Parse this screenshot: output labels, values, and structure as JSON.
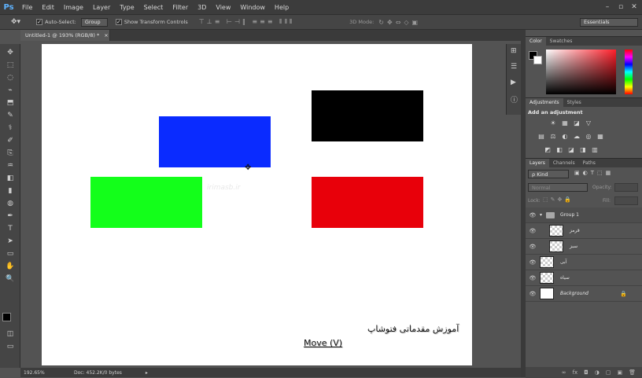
{
  "app": {
    "logo": "Ps"
  },
  "menu": [
    "File",
    "Edit",
    "Image",
    "Layer",
    "Type",
    "Select",
    "Filter",
    "3D",
    "View",
    "Window",
    "Help"
  ],
  "window_controls": [
    "–",
    "▫",
    "✕"
  ],
  "options": {
    "auto_select_label": "Auto-Select:",
    "auto_select_value": "Group",
    "show_transform_label": "Show Transform Controls",
    "mode_3d_label": "3D Mode:",
    "workspace_value": "Essentials"
  },
  "document": {
    "tab_title": "Untitled-1 @ 193% (RGB/8) *",
    "tab_close": "×",
    "zoom": "192.65%",
    "doc_info": "Doc: 452.2K/0 bytes",
    "status_arrow": "▸"
  },
  "canvas": {
    "watermark": "irimasb.ir",
    "shapes": [
      {
        "name": "blue",
        "color": "#0a2bff"
      },
      {
        "name": "black",
        "color": "#000000"
      },
      {
        "name": "green",
        "color": "#13ff1a"
      },
      {
        "name": "red",
        "color": "#e8000a"
      }
    ]
  },
  "overlay": {
    "persian_title": "آموزش مقدماتی فتوشاپ",
    "tool_caption": "Move (V)"
  },
  "color_panel": {
    "tabs": [
      "Color",
      "Swatches"
    ],
    "fg": "#000000",
    "bg": "#ffffff"
  },
  "adjustments_panel": {
    "tabs": [
      "Adjustments",
      "Styles"
    ],
    "heading": "Add an adjustment",
    "icons_row1": [
      "☀",
      "▦",
      "◪",
      "▽"
    ],
    "icons_row2": [
      "▤",
      "⚖",
      "◐",
      "☁",
      "◎",
      "▦"
    ],
    "icons_row3": [
      "◩",
      "◧",
      "◪",
      "◨",
      "▥"
    ]
  },
  "layers_panel": {
    "tabs": [
      "Layers",
      "Channels",
      "Paths"
    ],
    "filter_label": "ρ Kind",
    "blend_mode": "Normal",
    "opacity_label": "Opacity:",
    "fill_label": "Fill:",
    "lock_label": "Lock:",
    "layers": [
      {
        "name": "Group 1",
        "type": "group"
      },
      {
        "name": "قرمز",
        "type": "layer"
      },
      {
        "name": "سبز",
        "type": "layer"
      },
      {
        "name": "آبی",
        "type": "layer"
      },
      {
        "name": "سیاه",
        "type": "layer"
      },
      {
        "name": "Background",
        "type": "background"
      }
    ],
    "footer_icons": [
      "∞",
      "fx",
      "◘",
      "◑",
      "▢",
      "▣",
      "🗑"
    ]
  },
  "toolbar": {
    "tools": [
      "✥",
      "⬚",
      "◌",
      "⌁",
      "⬒",
      "✎",
      "⚕",
      "✐",
      "⎘",
      "♒",
      "◧",
      "▮",
      "◍",
      "✒",
      "T",
      "➤",
      "▭",
      "✋",
      "🔍"
    ]
  }
}
